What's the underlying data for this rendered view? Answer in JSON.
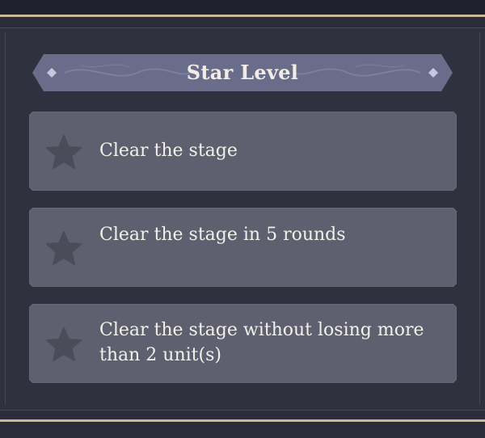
{
  "panel": {
    "title": "Star Level",
    "objectives": [
      {
        "text": "Clear the stage",
        "icon": "star-icon",
        "achieved": false
      },
      {
        "text": "Clear the stage in 5 rounds",
        "icon": "star-icon",
        "achieved": false
      },
      {
        "text": "Clear the stage without losing more than 2 unit(s)",
        "icon": "star-icon",
        "achieved": false
      }
    ]
  },
  "colors": {
    "background": "#2f323e",
    "accent_gold": "#c9b995",
    "card": "#5d5f6f",
    "banner": "#6a6e8a",
    "star_unachieved": "#494b59",
    "text": "#f3f0ea"
  }
}
